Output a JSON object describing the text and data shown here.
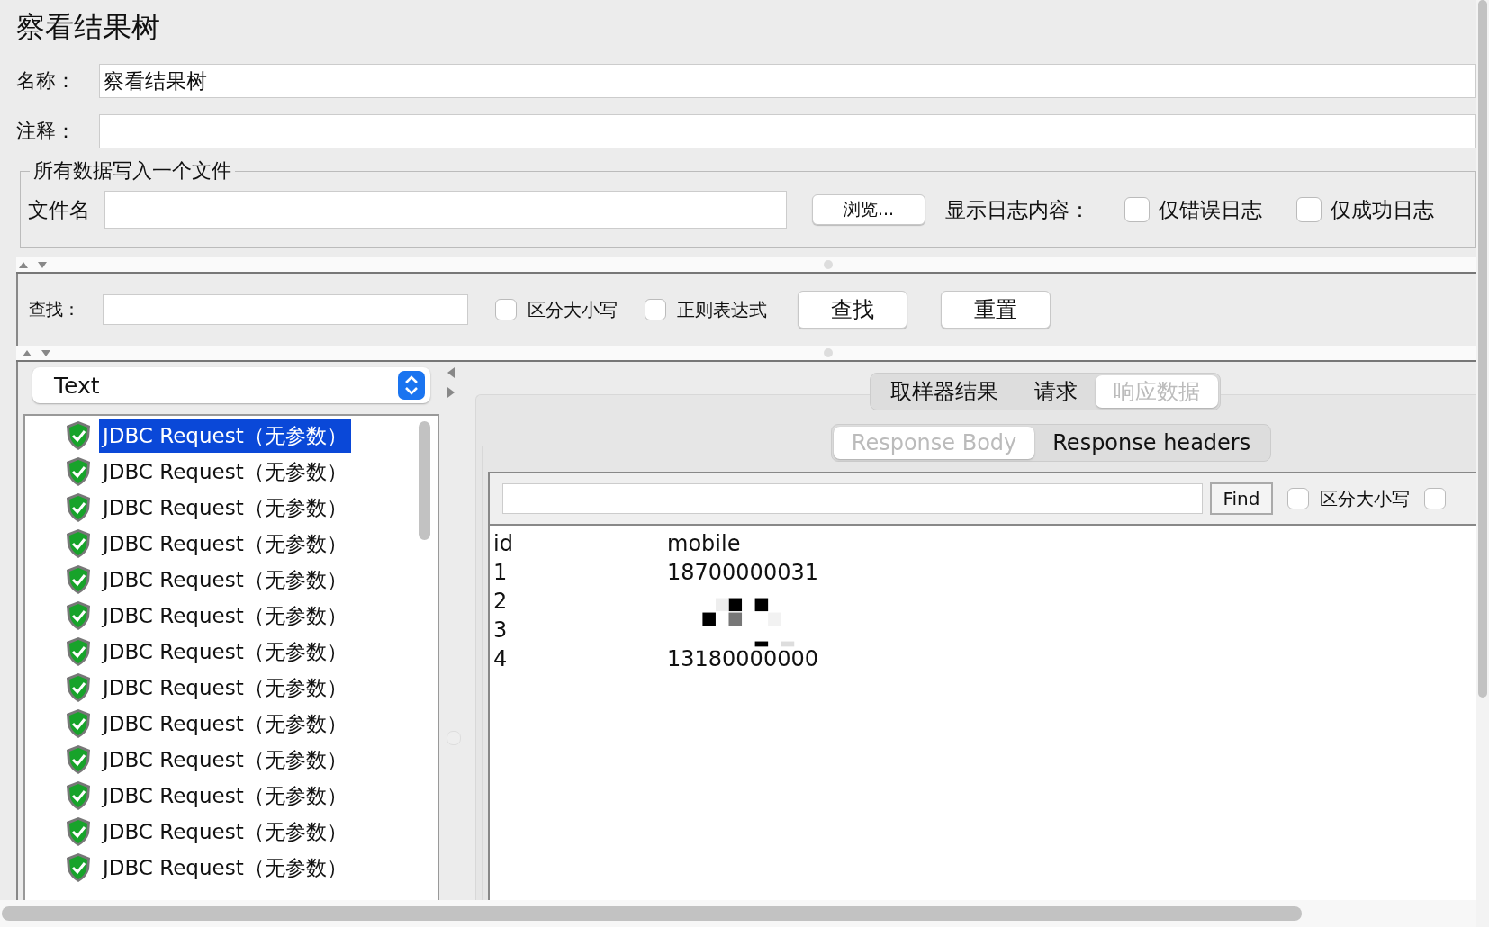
{
  "title": "察看结果树",
  "name_field": {
    "label": "名称：",
    "value": "察看结果树"
  },
  "comment_field": {
    "label": "注释："
  },
  "file_group": {
    "legend": "所有数据写入一个文件",
    "filename_label": "文件名",
    "browse_button": "浏览...",
    "log_label": "显示日志内容：",
    "options": [
      {
        "label": "仅错误日志",
        "checked": false
      },
      {
        "label": "仅成功日志",
        "checked": false
      }
    ]
  },
  "search": {
    "label": "查找：",
    "options": [
      {
        "label": "区分大小写",
        "checked": false
      },
      {
        "label": "正则表达式",
        "checked": false
      }
    ],
    "buttons": [
      "查找",
      "重置"
    ]
  },
  "renderer": {
    "value": "Text"
  },
  "tree_items": [
    {
      "label": "JDBC Request（无参数）",
      "selected": true
    },
    {
      "label": "JDBC Request（无参数）",
      "selected": false
    },
    {
      "label": "JDBC Request（无参数）",
      "selected": false
    },
    {
      "label": "JDBC Request（无参数）",
      "selected": false
    },
    {
      "label": "JDBC Request（无参数）",
      "selected": false
    },
    {
      "label": "JDBC Request（无参数）",
      "selected": false
    },
    {
      "label": "JDBC Request（无参数）",
      "selected": false
    },
    {
      "label": "JDBC Request（无参数）",
      "selected": false
    },
    {
      "label": "JDBC Request（无参数）",
      "selected": false
    },
    {
      "label": "JDBC Request（无参数）",
      "selected": false
    },
    {
      "label": "JDBC Request（无参数）",
      "selected": false
    },
    {
      "label": "JDBC Request（无参数）",
      "selected": false
    },
    {
      "label": "JDBC Request（无参数）",
      "selected": false
    }
  ],
  "result_tabs": [
    {
      "label": "取样器结果",
      "selected": false
    },
    {
      "label": "请求",
      "selected": false
    },
    {
      "label": "响应数据",
      "selected": true
    }
  ],
  "body_tabs": [
    {
      "label": "Response Body",
      "selected": true
    },
    {
      "label": "Response headers",
      "selected": false
    }
  ],
  "find_bar": {
    "button": "Find",
    "options": [
      {
        "label": "区分大小写",
        "checked": false
      },
      {
        "checked": false
      }
    ]
  },
  "response_table": {
    "columns": [
      "id",
      "mobile"
    ],
    "rows": [
      [
        "1",
        "18700000031"
      ],
      [
        "2"
      ],
      [
        "3"
      ],
      [
        "4",
        "13180000000"
      ]
    ]
  }
}
